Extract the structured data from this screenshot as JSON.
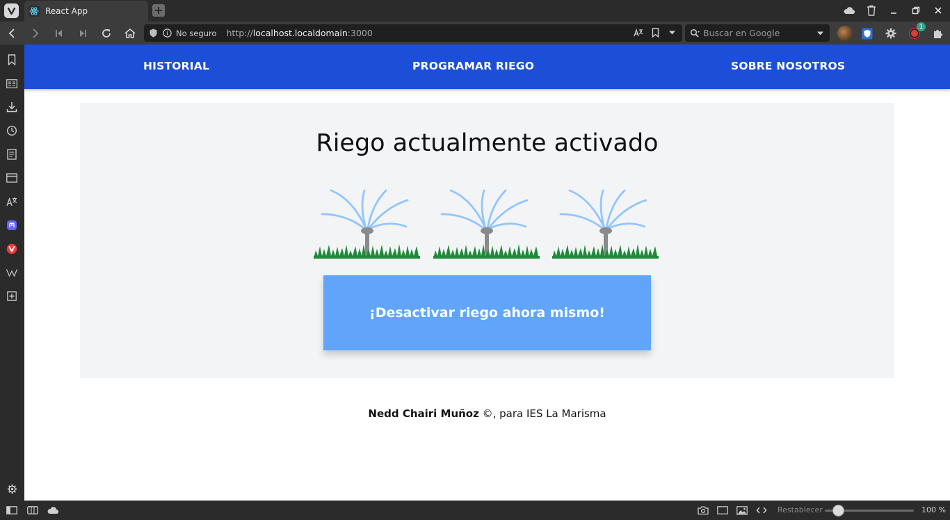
{
  "browser": {
    "tab": {
      "title": "React App"
    },
    "address": {
      "security_label": "No seguro",
      "url_scheme": "http://",
      "url_host": "localhost.localdomain",
      "url_port": ":3000"
    },
    "search": {
      "placeholder": "Buscar en Google"
    },
    "extensions_badge": "1",
    "status": {
      "reset_label": "Restablecer",
      "zoom": "100 %",
      "zoom_slider_fraction": 0.15
    }
  },
  "app": {
    "nav": {
      "historial": "HISTORIAL",
      "programar": "PROGRAMAR RIEGO",
      "sobre": "SOBRE NOSOTROS"
    },
    "card": {
      "title": "Riego actualmente activado",
      "button_label": "¡Desactivar riego ahora mismo!"
    },
    "footer": {
      "author": "Nedd Chairi Muñoz",
      "suffix": " ©, para IES La Marisma"
    }
  },
  "colors": {
    "nav_bg": "#1d4ed8",
    "card_bg": "#f3f4f6",
    "button_bg": "#60a5fa",
    "water": "#93c5fd",
    "grass": "#1f8a3a",
    "sprinkler": "#8a8a8a"
  }
}
